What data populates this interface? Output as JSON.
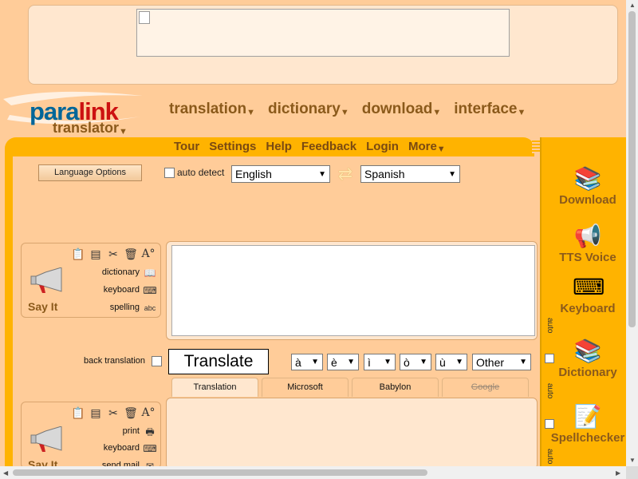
{
  "brand": {
    "para": "para",
    "link": "link",
    "product": "translator"
  },
  "topnav": [
    "translation",
    "dictionary",
    "download",
    "interface"
  ],
  "subnav": [
    "Tour",
    "Settings",
    "Help",
    "Feedback",
    "Login",
    "More"
  ],
  "language_options_label": "Language Options",
  "auto_detect_label": "auto detect",
  "source_language": "English",
  "target_language": "Spanish",
  "input_tools": {
    "say_it": "Say It",
    "links": [
      "dictionary",
      "keyboard",
      "spelling"
    ]
  },
  "output_tools": {
    "say_it": "Say It",
    "links": [
      "print",
      "keyboard",
      "send mail"
    ]
  },
  "back_translation_label": "back translation",
  "translate_button": "Translate",
  "accent_selects": [
    "à",
    "è",
    "ì",
    "ò",
    "ù",
    "Other"
  ],
  "engine_tabs": [
    "Translation",
    "Microsoft",
    "Babylon",
    "Google"
  ],
  "sidebar": {
    "auto_label": "auto",
    "items": [
      "Download",
      "TTS Voice",
      "Keyboard",
      "Dictionary",
      "Spellchecker"
    ]
  },
  "colors": {
    "accent": "#FFB300",
    "background": "#FFCC99",
    "nav_text": "#8B5A1B",
    "brand_blue": "#006699",
    "brand_red": "#CC1111"
  }
}
